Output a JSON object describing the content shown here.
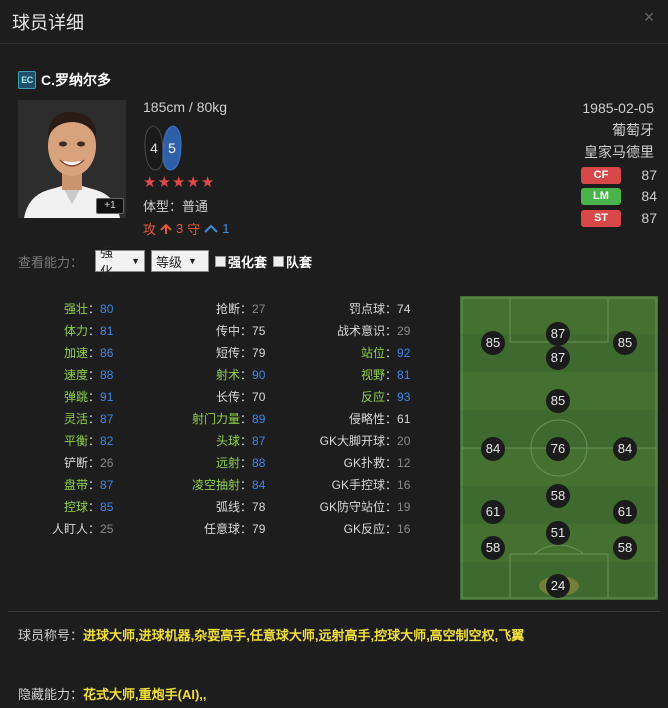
{
  "window": {
    "title": "球员详细",
    "close_glyph": "×"
  },
  "player": {
    "season_badge": "EC",
    "name": "C.罗纳尔多",
    "height_weight": "185cm / 80kg",
    "weak_foot_left": "4",
    "weak_foot_right": "5",
    "stars": 5,
    "body_type": "体型：普通",
    "upgrade_badge": "+1",
    "workrate": {
      "atk_label": "攻",
      "atk_value": "3",
      "def_label": "守",
      "def_value": "1"
    },
    "birth": "1985-02-05",
    "nation": "葡萄牙",
    "club": "皇家马德里",
    "positions": [
      {
        "tag": "CF",
        "value": "87",
        "color": "#d94848"
      },
      {
        "tag": "LM",
        "value": "84",
        "color": "#49b44a"
      },
      {
        "tag": "ST",
        "value": "87",
        "color": "#d94848"
      }
    ]
  },
  "view": {
    "label": "查看能力：",
    "select1": "强化",
    "select2": "等级",
    "chk1": "强化套",
    "chk2": "队套"
  },
  "stats": {
    "col1": [
      {
        "label": "强壮",
        "value": "80",
        "lc": "green",
        "vc": "blue"
      },
      {
        "label": "体力",
        "value": "81",
        "lc": "green",
        "vc": "blue"
      },
      {
        "label": "加速",
        "value": "86",
        "lc": "green",
        "vc": "blue"
      },
      {
        "label": "速度",
        "value": "88",
        "lc": "green",
        "vc": "blue"
      },
      {
        "label": "弹跳",
        "value": "91",
        "lc": "green",
        "vc": "blue"
      },
      {
        "label": "灵活",
        "value": "87",
        "lc": "green",
        "vc": "blue"
      },
      {
        "label": "平衡",
        "value": "82",
        "lc": "green",
        "vc": "blue"
      },
      {
        "label": "铲断",
        "value": "26",
        "lc": "white",
        "vc": "gray"
      },
      {
        "label": "盘带",
        "value": "87",
        "lc": "green",
        "vc": "blue"
      },
      {
        "label": "控球",
        "value": "85",
        "lc": "green",
        "vc": "blue"
      },
      {
        "label": "人盯人",
        "value": "25",
        "lc": "white",
        "vc": "gray"
      }
    ],
    "col2": [
      {
        "label": "抢断",
        "value": "27",
        "lc": "white",
        "vc": "gray"
      },
      {
        "label": "传中",
        "value": "75",
        "lc": "white",
        "vc": "white"
      },
      {
        "label": "短传",
        "value": "79",
        "lc": "white",
        "vc": "white"
      },
      {
        "label": "射术",
        "value": "90",
        "lc": "green",
        "vc": "blue"
      },
      {
        "label": "长传",
        "value": "70",
        "lc": "white",
        "vc": "white"
      },
      {
        "label": "射门力量",
        "value": "89",
        "lc": "green",
        "vc": "blue"
      },
      {
        "label": "头球",
        "value": "87",
        "lc": "green",
        "vc": "blue"
      },
      {
        "label": "远射",
        "value": "88",
        "lc": "green",
        "vc": "blue"
      },
      {
        "label": "凌空抽射",
        "value": "84",
        "lc": "green",
        "vc": "blue"
      },
      {
        "label": "弧线",
        "value": "78",
        "lc": "white",
        "vc": "white"
      },
      {
        "label": "任意球",
        "value": "79",
        "lc": "white",
        "vc": "white"
      }
    ],
    "col3": [
      {
        "label": "罚点球",
        "value": "74",
        "lc": "white",
        "vc": "white"
      },
      {
        "label": "战术意识",
        "value": "29",
        "lc": "white",
        "vc": "gray"
      },
      {
        "label": "站位",
        "value": "92",
        "lc": "green",
        "vc": "blue"
      },
      {
        "label": "视野",
        "value": "81",
        "lc": "green",
        "vc": "blue"
      },
      {
        "label": "反应",
        "value": "93",
        "lc": "green",
        "vc": "blue"
      },
      {
        "label": "侵略性",
        "value": "61",
        "lc": "white",
        "vc": "white"
      },
      {
        "label": "GK大脚开球",
        "value": "20",
        "lc": "white",
        "vc": "gray"
      },
      {
        "label": "GK扑救",
        "value": "12",
        "lc": "white",
        "vc": "gray"
      },
      {
        "label": "GK手控球",
        "value": "16",
        "lc": "white",
        "vc": "gray"
      },
      {
        "label": "GK防守站位",
        "value": "19",
        "lc": "white",
        "vc": "gray"
      },
      {
        "label": "GK反应",
        "value": "16",
        "lc": "white",
        "vc": "gray"
      }
    ]
  },
  "pitch_ratings": {
    "ST": "87",
    "LW": "85",
    "RW": "85",
    "CF": "87",
    "CAM": "85",
    "LM": "84",
    "CM": "76",
    "RM": "84",
    "CDM": "58",
    "LWB": "61",
    "RWB": "61",
    "LB": "58",
    "CB": "51",
    "RB": "58",
    "GK": "24"
  },
  "footer": {
    "titles_label": "球员称号：",
    "titles_value": "进球大师,进球机器,杂耍高手,任意球大师,远射高手,控球大师,高空制空权,飞翼",
    "hidden_label": "隐藏能力：",
    "hidden_value": "花式大师,重炮手(AI),,"
  },
  "colors": {
    "green": "#8ed24a",
    "white": "#d8d8d8",
    "gray": "#8a8a8a",
    "blue": "#3f86e6"
  }
}
